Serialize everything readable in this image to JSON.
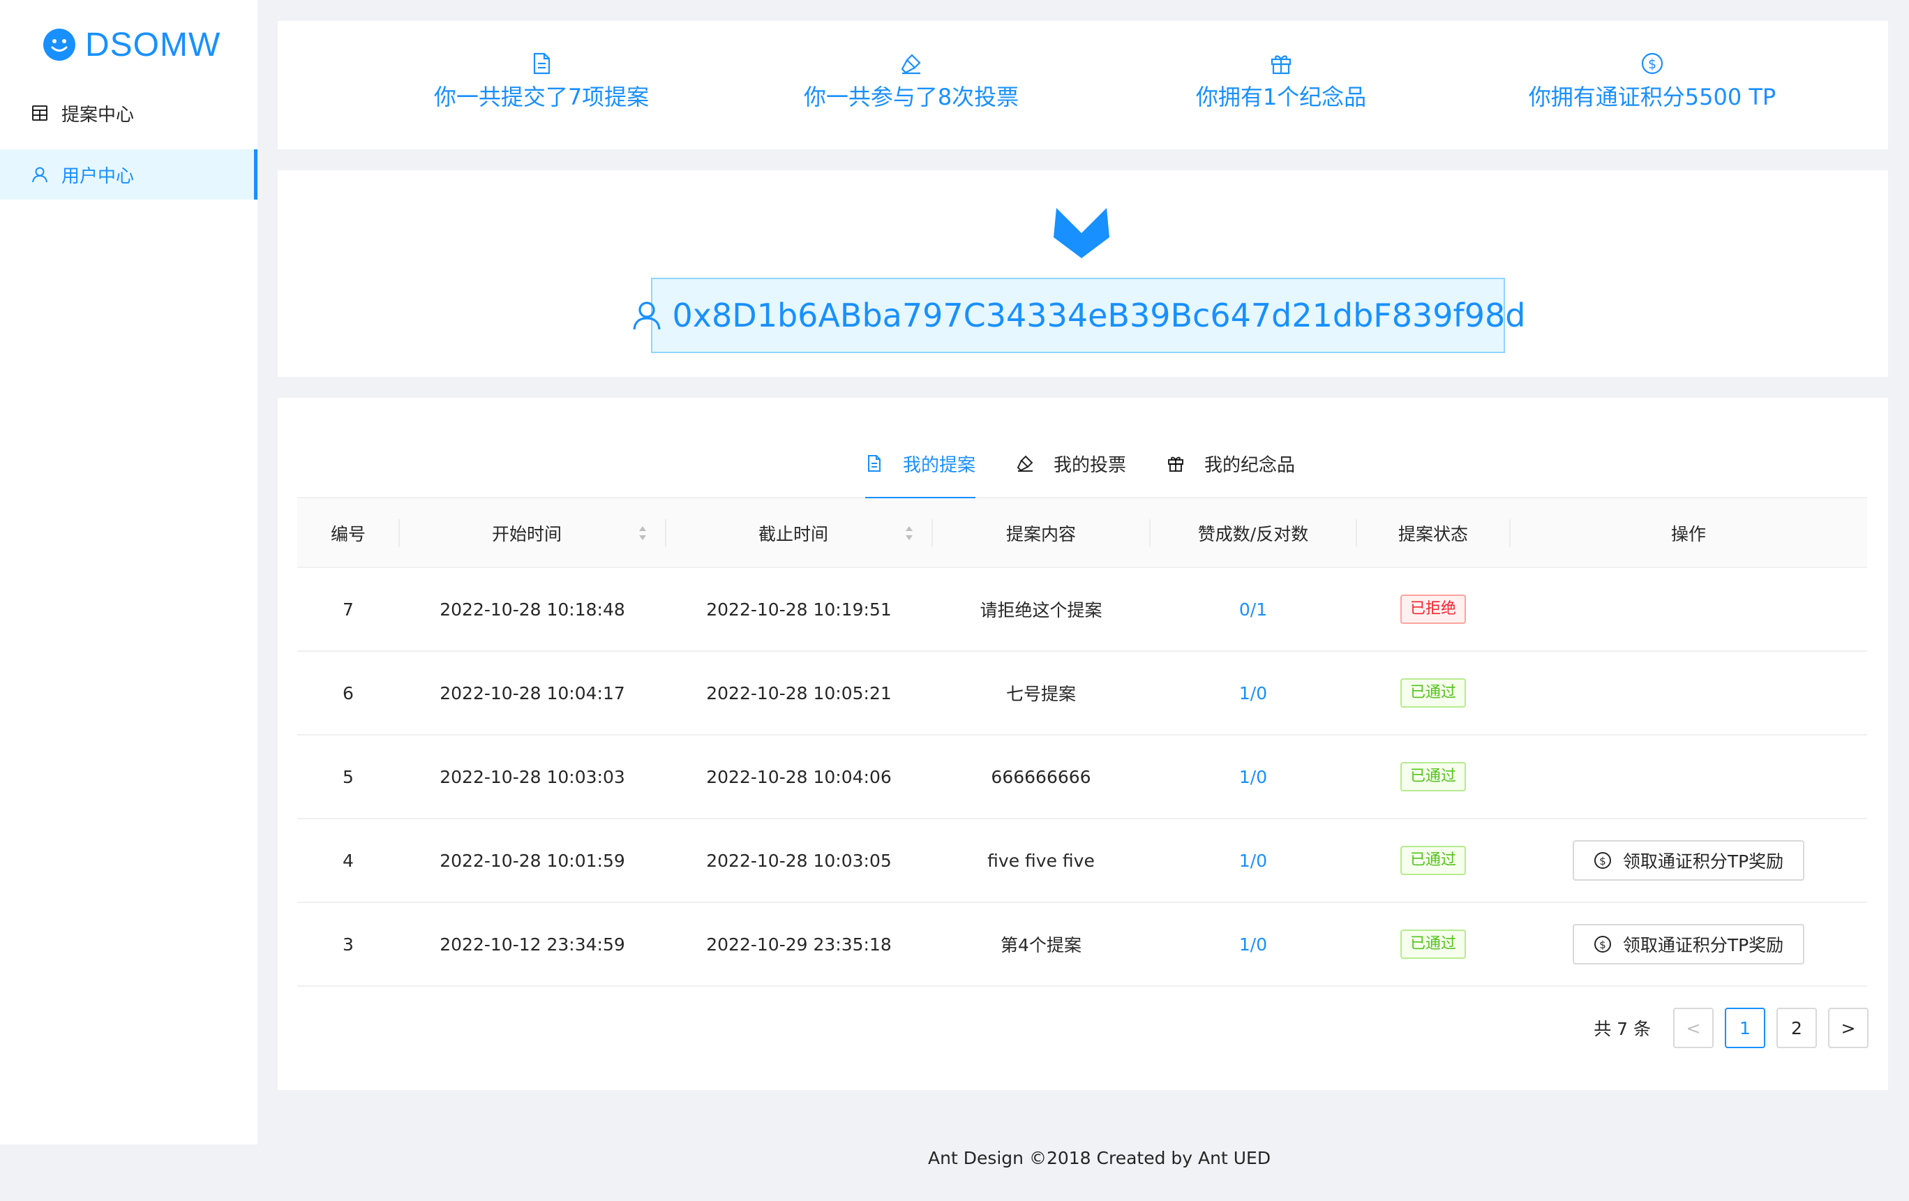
{
  "app": {
    "logo_text": "DSOMW"
  },
  "sidebar": {
    "items": [
      {
        "label": "提案中心",
        "icon": "table-icon",
        "active": false
      },
      {
        "label": "用户中心",
        "icon": "user-icon",
        "active": true
      }
    ]
  },
  "stats": {
    "proposals": "你一共提交了7项提案",
    "votes": "你一共参与了8次投票",
    "souvenirs": "你拥有1个纪念品",
    "tokens": "你拥有通证积分5500 TP"
  },
  "profile": {
    "address": "0x8D1b6ABba797C34334eB39Bc647d21dbF839f98d"
  },
  "tabs": [
    {
      "label": "我的提案",
      "icon": "file-icon",
      "active": true
    },
    {
      "label": "我的投票",
      "icon": "hammer-icon",
      "active": false
    },
    {
      "label": "我的纪念品",
      "icon": "gift-icon",
      "active": false
    }
  ],
  "table": {
    "columns": [
      "编号",
      "开始时间",
      "截止时间",
      "提案内容",
      "赞成数/反对数",
      "提案状态",
      "操作"
    ],
    "rows": [
      {
        "id": "7",
        "start": "2022-10-28 10:18:48",
        "end": "2022-10-28 10:19:51",
        "content": "请拒绝这个提案",
        "votes": "0/1",
        "status": "已拒绝",
        "status_type": "rejected",
        "action": ""
      },
      {
        "id": "6",
        "start": "2022-10-28 10:04:17",
        "end": "2022-10-28 10:05:21",
        "content": "七号提案",
        "votes": "1/0",
        "status": "已通过",
        "status_type": "passed",
        "action": ""
      },
      {
        "id": "5",
        "start": "2022-10-28 10:03:03",
        "end": "2022-10-28 10:04:06",
        "content": "666666666",
        "votes": "1/0",
        "status": "已通过",
        "status_type": "passed",
        "action": ""
      },
      {
        "id": "4",
        "start": "2022-10-28 10:01:59",
        "end": "2022-10-28 10:03:05",
        "content": "five five five",
        "votes": "1/0",
        "status": "已通过",
        "status_type": "passed",
        "action": "领取通证积分TP奖励"
      },
      {
        "id": "3",
        "start": "2022-10-12 23:34:59",
        "end": "2022-10-29 23:35:18",
        "content": "第4个提案",
        "votes": "1/0",
        "status": "已通过",
        "status_type": "passed",
        "action": "领取通证积分TP奖励"
      }
    ]
  },
  "pagination": {
    "total": "共 7 条",
    "pages": [
      "1",
      "2"
    ],
    "current": "1",
    "prev": "<",
    "next": ">"
  },
  "footer": {
    "text": "Ant Design ©2018 Created by Ant UED"
  },
  "colors": {
    "primary": "#1890ff",
    "success": "#52c41a",
    "error": "#f5222d",
    "bg": "#f0f2f5"
  }
}
